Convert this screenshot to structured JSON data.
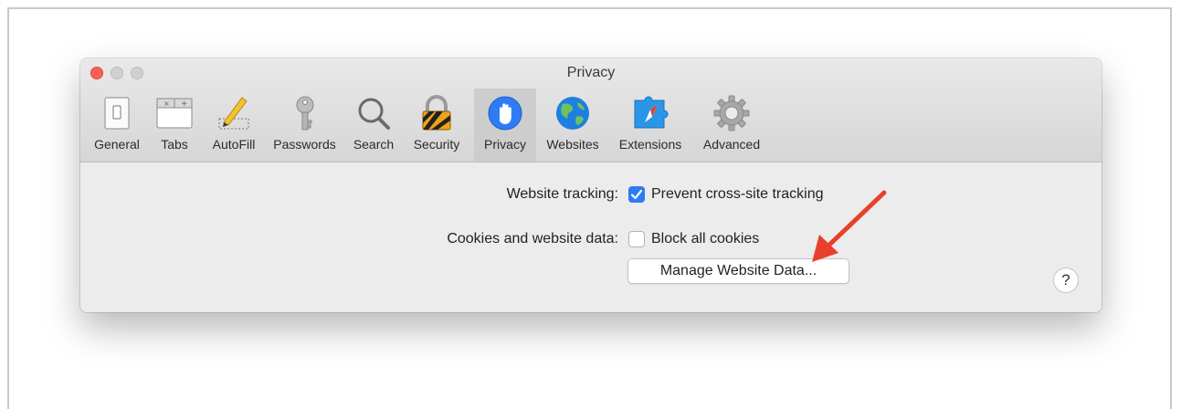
{
  "window": {
    "title": "Privacy"
  },
  "toolbar": {
    "tabs": [
      {
        "label": "General",
        "icon": "general-switch-icon"
      },
      {
        "label": "Tabs",
        "icon": "tabs-icon"
      },
      {
        "label": "AutoFill",
        "icon": "pencil-icon"
      },
      {
        "label": "Passwords",
        "icon": "key-icon"
      },
      {
        "label": "Search",
        "icon": "magnifier-icon"
      },
      {
        "label": "Security",
        "icon": "padlock-icon"
      },
      {
        "label": "Privacy",
        "icon": "hand-icon",
        "active": true
      },
      {
        "label": "Websites",
        "icon": "globe-icon"
      },
      {
        "label": "Extensions",
        "icon": "puzzle-compass-icon"
      },
      {
        "label": "Advanced",
        "icon": "gear-icon"
      }
    ]
  },
  "privacy": {
    "tracking_label": "Website tracking:",
    "tracking_option": "Prevent cross-site tracking",
    "tracking_checked": true,
    "cookies_label": "Cookies and website data:",
    "cookies_option": "Block all cookies",
    "cookies_checked": false,
    "manage_button": "Manage Website Data...",
    "help": "?"
  },
  "colors": {
    "accent": "#2f7bf5",
    "arrow": "#e8402a",
    "close": "#fc5f57"
  }
}
